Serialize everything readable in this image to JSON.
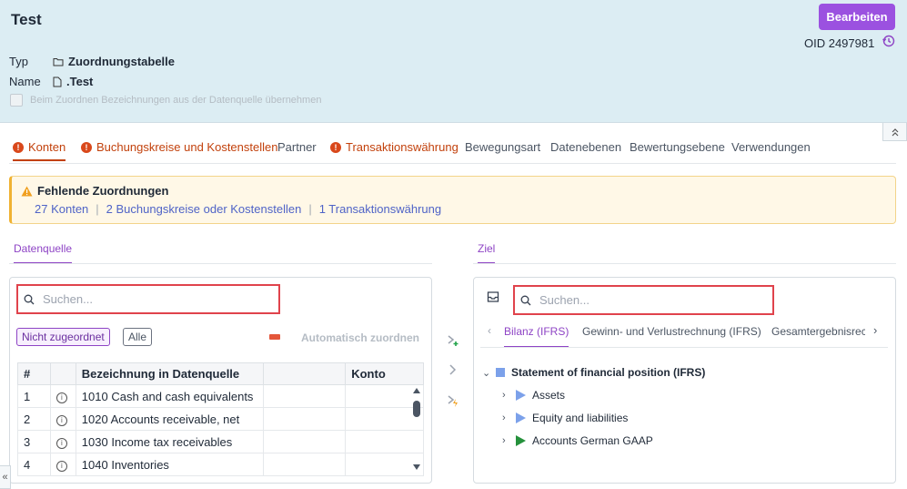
{
  "header": {
    "title": "Test",
    "edit_label": "Bearbeiten",
    "oid": "OID 2497981",
    "type_label": "Typ",
    "type_value": "Zuordnungstabelle",
    "name_label": "Name",
    "name_value": ".Test",
    "checkbox_label": "Beim Zuordnen Bezeichnungen aus der Datenquelle übernehmen"
  },
  "tabs": [
    {
      "label": "Konten",
      "warn": true
    },
    {
      "label": "Buchungskreise und Kostenstellen",
      "warn": true
    },
    {
      "label": "Partner",
      "warn": false
    },
    {
      "label": "Transaktionswährung",
      "warn": true
    },
    {
      "label": "Bewegungsart",
      "warn": false
    },
    {
      "label": "Datenebenen",
      "warn": false
    },
    {
      "label": "Bewertungsebene",
      "warn": false
    },
    {
      "label": "Verwendungen",
      "warn": false
    }
  ],
  "alert": {
    "title": "Fehlende Zuordnungen",
    "links": [
      "27 Konten",
      "2 Buchungskreise oder Kostenstellen",
      "1 Transaktionswährung"
    ],
    "sep": "|"
  },
  "source": {
    "tab": "Datenquelle",
    "search_placeholder": "Suchen...",
    "filter_unassigned": "Nicht zugeordnet",
    "filter_all": "Alle",
    "auto_assign": "Automatisch zuordnen",
    "columns": [
      "#",
      "",
      "Bezeichnung in Datenquelle",
      "",
      "Konto"
    ],
    "rows": [
      {
        "num": "1",
        "name": "1010 Cash and cash equivalents"
      },
      {
        "num": "2",
        "name": "1020 Accounts receivable, net"
      },
      {
        "num": "3",
        "name": "1030 Income tax receivables"
      },
      {
        "num": "4",
        "name": "1040 Inventories"
      }
    ]
  },
  "target": {
    "tab": "Ziel",
    "search_placeholder": "Suchen...",
    "tabs": [
      "Bilanz (IFRS)",
      "Gewinn- und Verlustrechnung (IFRS)",
      "Gesamtergebnisrec"
    ],
    "tree_root": "Statement of financial position (IFRS)",
    "tree_children": [
      "Assets",
      "Equity and liabilities",
      "Accounts German GAAP"
    ]
  },
  "colors": {
    "accent": "#9b51e0",
    "warn": "#c2410c",
    "highlight": "#e0434c",
    "link": "#4f63c7"
  }
}
